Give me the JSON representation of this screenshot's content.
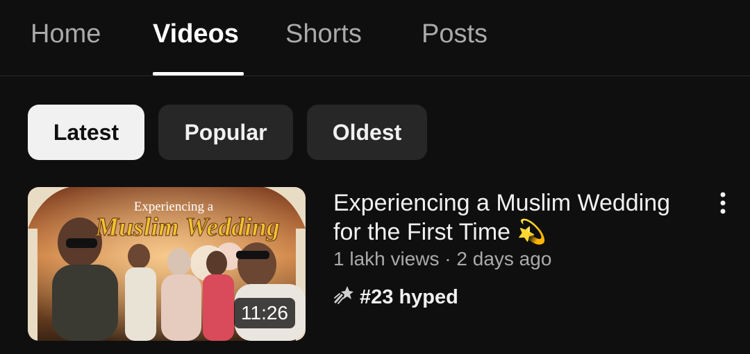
{
  "tabs": [
    {
      "label": "Home"
    },
    {
      "label": "Videos"
    },
    {
      "label": "Shorts"
    },
    {
      "label": "Posts"
    }
  ],
  "active_tab": "Videos",
  "filters": [
    {
      "label": "Latest",
      "selected": true
    },
    {
      "label": "Popular",
      "selected": false
    },
    {
      "label": "Oldest",
      "selected": false
    }
  ],
  "video": {
    "title": "Experiencing a Muslim Wedding for the First Time 💫",
    "thumbnail_text_top": "Experiencing a",
    "thumbnail_text_main": "Muslim Wedding",
    "duration": "11:26",
    "views": "1 lakh views",
    "separator": "·",
    "age": "2 days ago",
    "hype_label": "#23 hyped",
    "hype_icon": "hype-icon",
    "menu_icon": "more-vert-icon"
  },
  "colors": {
    "background": "#0f0f0f",
    "chip": "#272727",
    "chip_selected": "#f1f1f1",
    "secondary_text": "#aaaaaa",
    "thumbnail_title_gold": "#f2c230"
  }
}
